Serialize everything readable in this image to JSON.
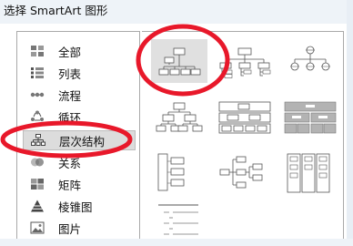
{
  "dialog": {
    "title": "选择 SmartArt 图形"
  },
  "categories": [
    {
      "label": "全部",
      "icon": "all-icon"
    },
    {
      "label": "列表",
      "icon": "list-icon"
    },
    {
      "label": "流程",
      "icon": "process-icon"
    },
    {
      "label": "循环",
      "icon": "cycle-icon"
    },
    {
      "label": "层次结构",
      "icon": "hierarchy-icon",
      "selected": true
    },
    {
      "label": "关系",
      "icon": "relationship-icon"
    },
    {
      "label": "矩阵",
      "icon": "matrix-icon"
    },
    {
      "label": "棱锥图",
      "icon": "pyramid-icon"
    },
    {
      "label": "图片",
      "icon": "picture-icon"
    }
  ],
  "annotations": {
    "color": "#e8182a"
  },
  "colors": {
    "box_fill": "#8c8c8c",
    "box_stroke": "#5a5a5a",
    "selected_bg": "#dcdcdc"
  }
}
